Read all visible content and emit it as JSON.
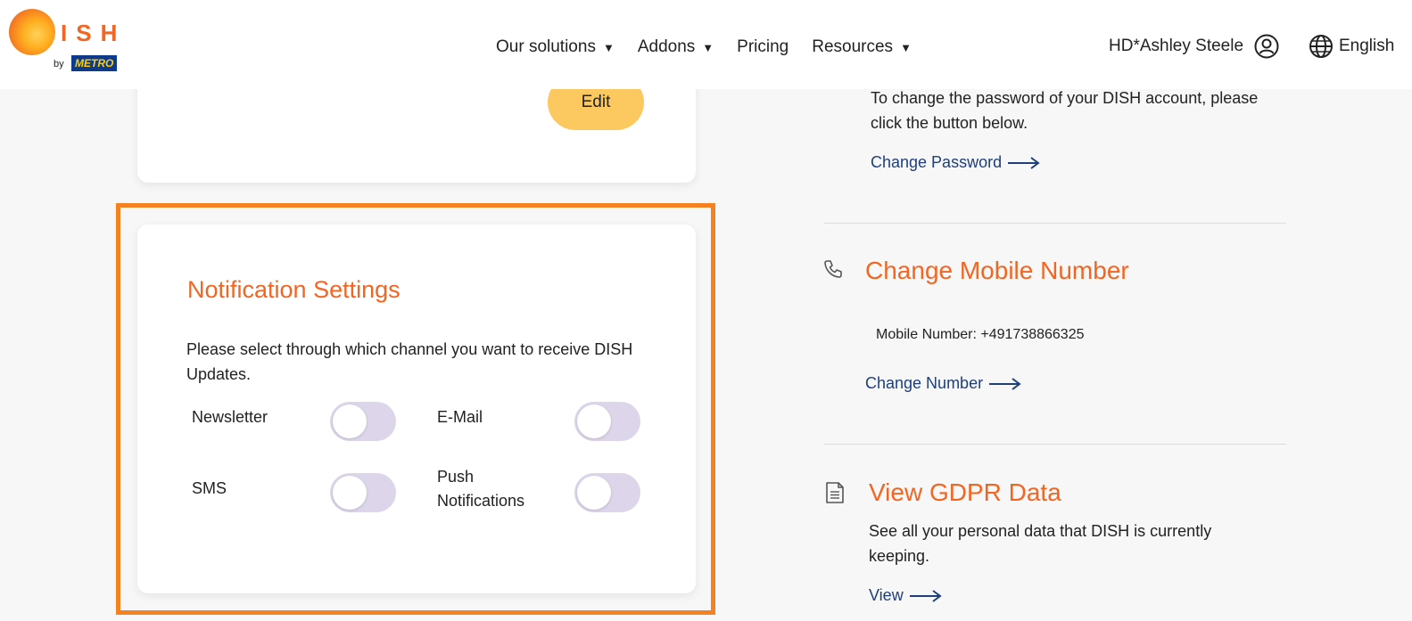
{
  "header": {
    "logo": {
      "letters": "ISH",
      "by": "by",
      "metro": "METRO"
    },
    "nav": [
      {
        "label": "Our solutions",
        "has_caret": true
      },
      {
        "label": "Addons",
        "has_caret": true
      },
      {
        "label": "Pricing",
        "has_caret": false
      },
      {
        "label": "Resources",
        "has_caret": true
      }
    ],
    "caret": "▼",
    "user_name": "HD*Ashley Steele",
    "language": "English"
  },
  "profile_card": {
    "edit_label": "Edit"
  },
  "notifications": {
    "title": "Notification Settings",
    "description": "Please select through which channel you want to receive DISH Updates.",
    "options": {
      "newsletter": {
        "label": "Newsletter",
        "enabled": false
      },
      "email": {
        "label": "E-Mail",
        "enabled": false
      },
      "sms": {
        "label": "SMS",
        "enabled": false
      },
      "push": {
        "label": "Push Notifications",
        "enabled": false
      }
    }
  },
  "password": {
    "description": "To change the password of your DISH account, please click the button below.",
    "link": "Change Password"
  },
  "mobile": {
    "title": "Change Mobile Number",
    "number_text": "Mobile Number: +491738866325",
    "link": "Change Number"
  },
  "gdpr": {
    "title": "View GDPR Data",
    "description": "See all your personal data that DISH is currently keeping.",
    "link": "View"
  },
  "colors": {
    "accent": "#f26522",
    "highlight": "#f58220",
    "link": "#1f3f7a",
    "edit_button": "#fcc860",
    "toggle_off": "#ddd6ea"
  },
  "icons": [
    "user-icon",
    "globe-icon",
    "phone-icon",
    "document-icon",
    "arrow-right-icon"
  ]
}
